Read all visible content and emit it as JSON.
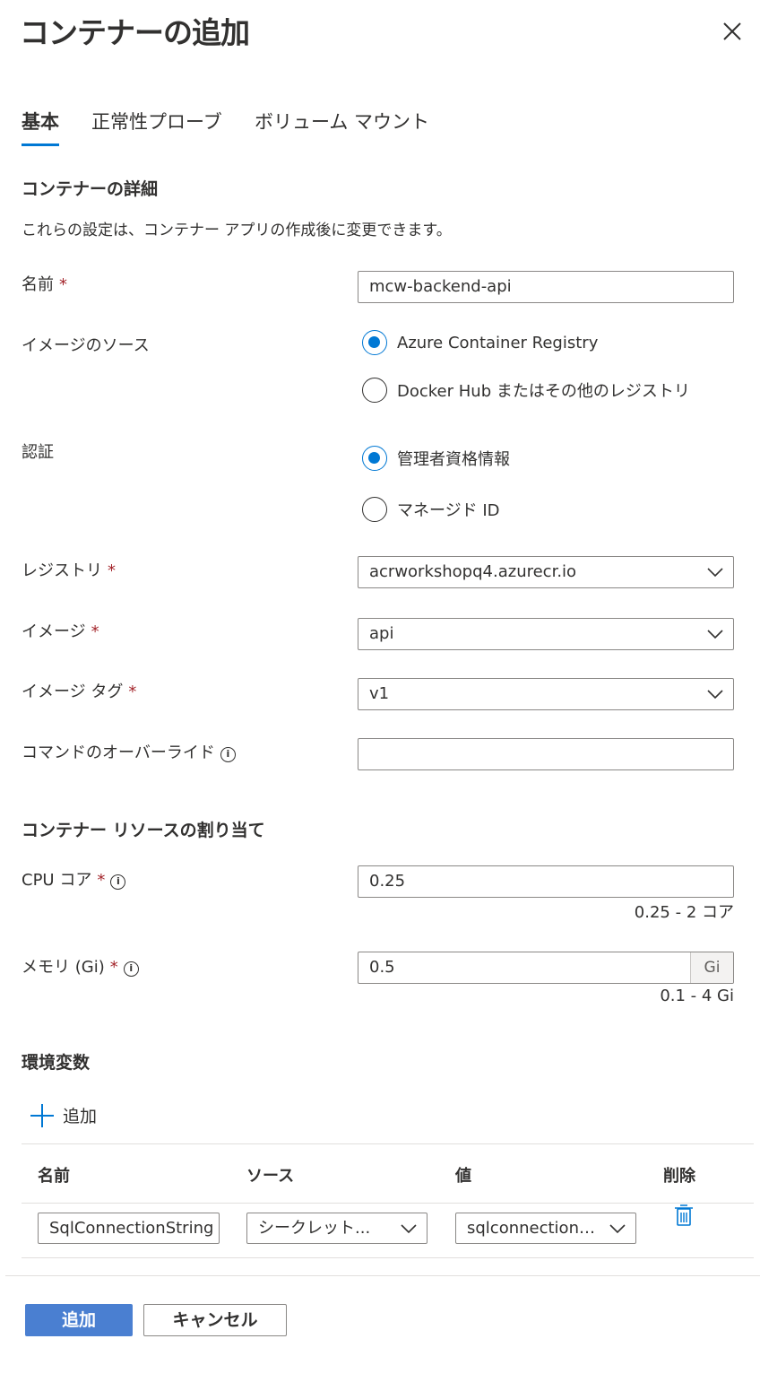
{
  "title": "コンテナーの追加",
  "tabs": [
    {
      "label": "基本",
      "active": true
    },
    {
      "label": "正常性プローブ",
      "active": false
    },
    {
      "label": "ボリューム マウント",
      "active": false
    }
  ],
  "details": {
    "heading": "コンテナーの詳細",
    "description": "これらの設定は、コンテナー アプリの作成後に変更できます。",
    "name_label": "名前",
    "name_value": "mcw-backend-api",
    "image_source_label": "イメージのソース",
    "image_source_options": [
      "Azure Container Registry",
      "Docker Hub またはその他のレジストリ"
    ],
    "image_source_selected": "Azure Container Registry",
    "auth_label": "認証",
    "auth_options": [
      "管理者資格情報",
      "マネージド ID"
    ],
    "auth_selected": "管理者資格情報",
    "registry_label": "レジストリ",
    "registry_value": "acrworkshopq4.azurecr.io",
    "image_label": "イメージ",
    "image_value": "api",
    "image_tag_label": "イメージ タグ",
    "image_tag_value": "v1",
    "command_override_label": "コマンドのオーバーライド",
    "command_override_value": ""
  },
  "resources": {
    "heading": "コンテナー リソースの割り当て",
    "cpu_label": "CPU コア",
    "cpu_value": "0.25",
    "cpu_range": "0.25 - 2 コア",
    "memory_label": "メモリ (Gi)",
    "memory_value": "0.5",
    "memory_unit": "Gi",
    "memory_range": "0.1 - 4 Gi"
  },
  "env": {
    "heading": "環境変数",
    "add_label": "追加",
    "columns": [
      "名前",
      "ソース",
      "値",
      "削除"
    ],
    "rows": [
      {
        "name": "SqlConnectionString",
        "source": "シークレット...",
        "value": "sqlconnections..."
      }
    ]
  },
  "footer": {
    "add_button": "追加",
    "cancel_button": "キャンセル"
  },
  "required_marker": "*",
  "info_marker": "i",
  "colors": {
    "accent": "#0078d4",
    "primary_button": "#4a7fd1",
    "required": "#a4262c",
    "text": "#323130"
  }
}
